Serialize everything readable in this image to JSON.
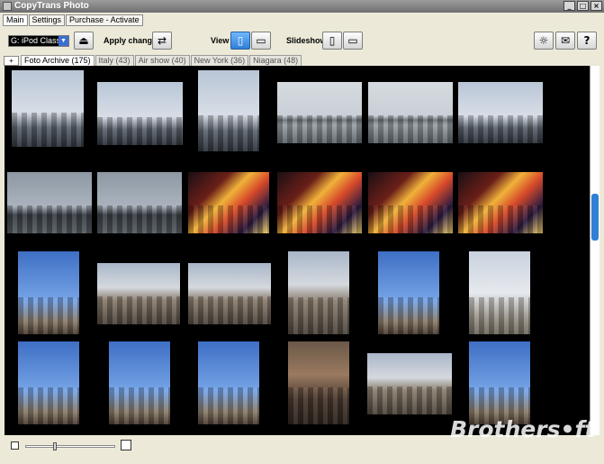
{
  "window": {
    "title": "CopyTrans Photo",
    "buttons": [
      "_",
      "□",
      "×"
    ]
  },
  "menu_tabs": [
    {
      "label": "Main",
      "active": true
    },
    {
      "label": "Settings",
      "active": false
    },
    {
      "label": "Purchase - Activate",
      "active": false
    }
  ],
  "toolbar": {
    "device": "G: iPod Classic",
    "apply_label": "Apply changes",
    "view_label": "View",
    "slideshow_label": "Slideshow"
  },
  "album_tabs": [
    {
      "label": "Foto Archive (175)",
      "active": true
    },
    {
      "label": "Italy (43)",
      "active": false
    },
    {
      "label": "Air show (40)",
      "active": false
    },
    {
      "label": "New York (36)",
      "active": false
    },
    {
      "label": "Niagara (48)",
      "active": false
    }
  ],
  "gallery_photos": [
    "manhattan-towers",
    "statue-of-liberty",
    "manhattan-skyscrapers",
    "brooklyn-bridge",
    "brooklyn-bridge",
    "manhattan-skyline",
    "skyline-from-window",
    "skyline-from-window",
    "times-square-night",
    "times-square-night",
    "times-square-night",
    "times-square-night",
    "hearst-tower",
    "globe-sculpture",
    "museum-street",
    "brick-buildings",
    "gothic-church",
    "winter-trees-building",
    "empire-state-building",
    "empire-state-building",
    "metlife-tower",
    "ornate-facade",
    "courthouse-building",
    "un-building"
  ],
  "colors": {
    "accent": "#2f7fd6",
    "gallery_bg": "#000000"
  },
  "watermark": "Brothers•ft"
}
